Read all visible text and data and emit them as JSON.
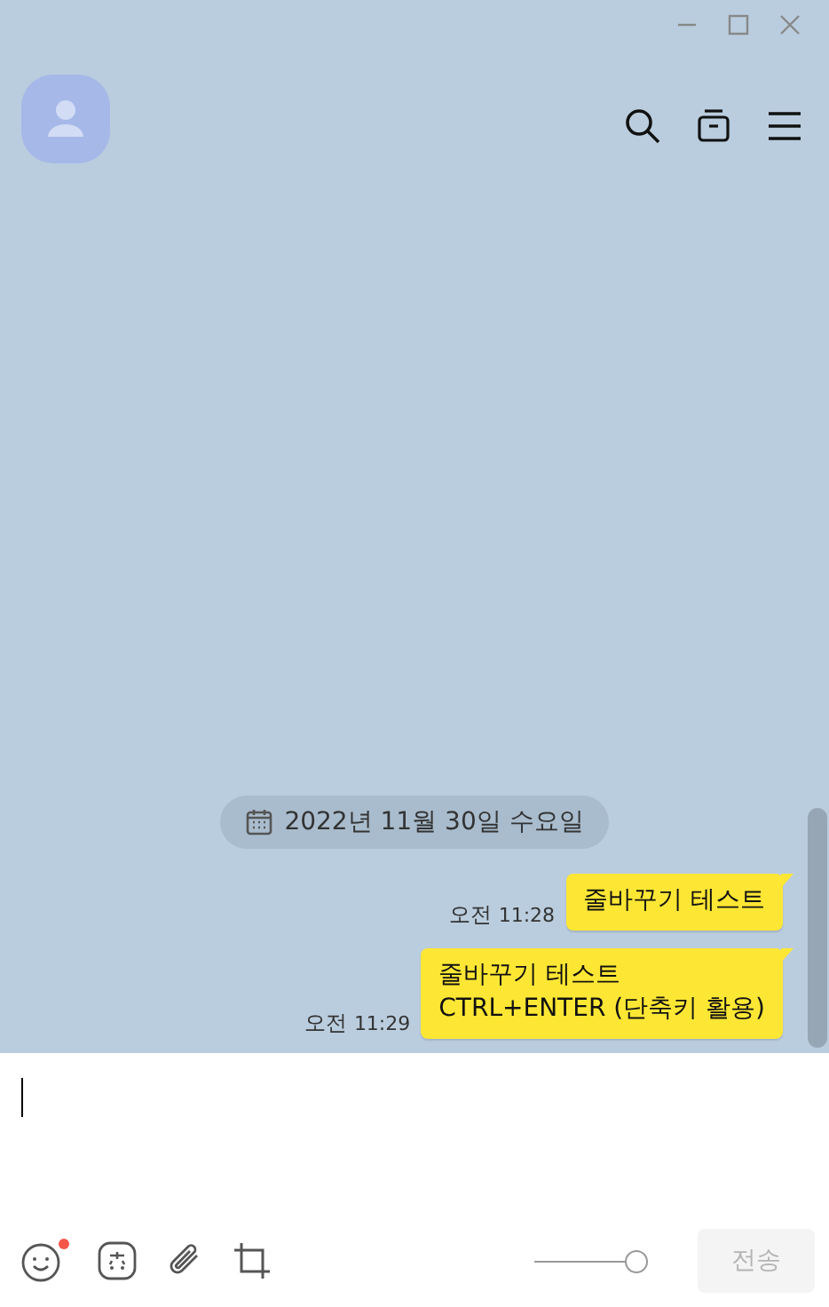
{
  "date_divider": {
    "text": "2022년 11월 30일 수요일"
  },
  "messages": [
    {
      "time_prefix": "오전",
      "time": "11:28",
      "lines": [
        "줄바꾸기 테스트"
      ]
    },
    {
      "time_prefix": "오전",
      "time": "11:29",
      "lines": [
        "줄바꾸기 테스트",
        "CTRL+ENTER (단축키 활용)"
      ]
    }
  ],
  "composer": {
    "emoticon_new": true,
    "slider": {
      "level": 1
    },
    "send_button": {
      "label": "전송",
      "disabled": true
    }
  }
}
